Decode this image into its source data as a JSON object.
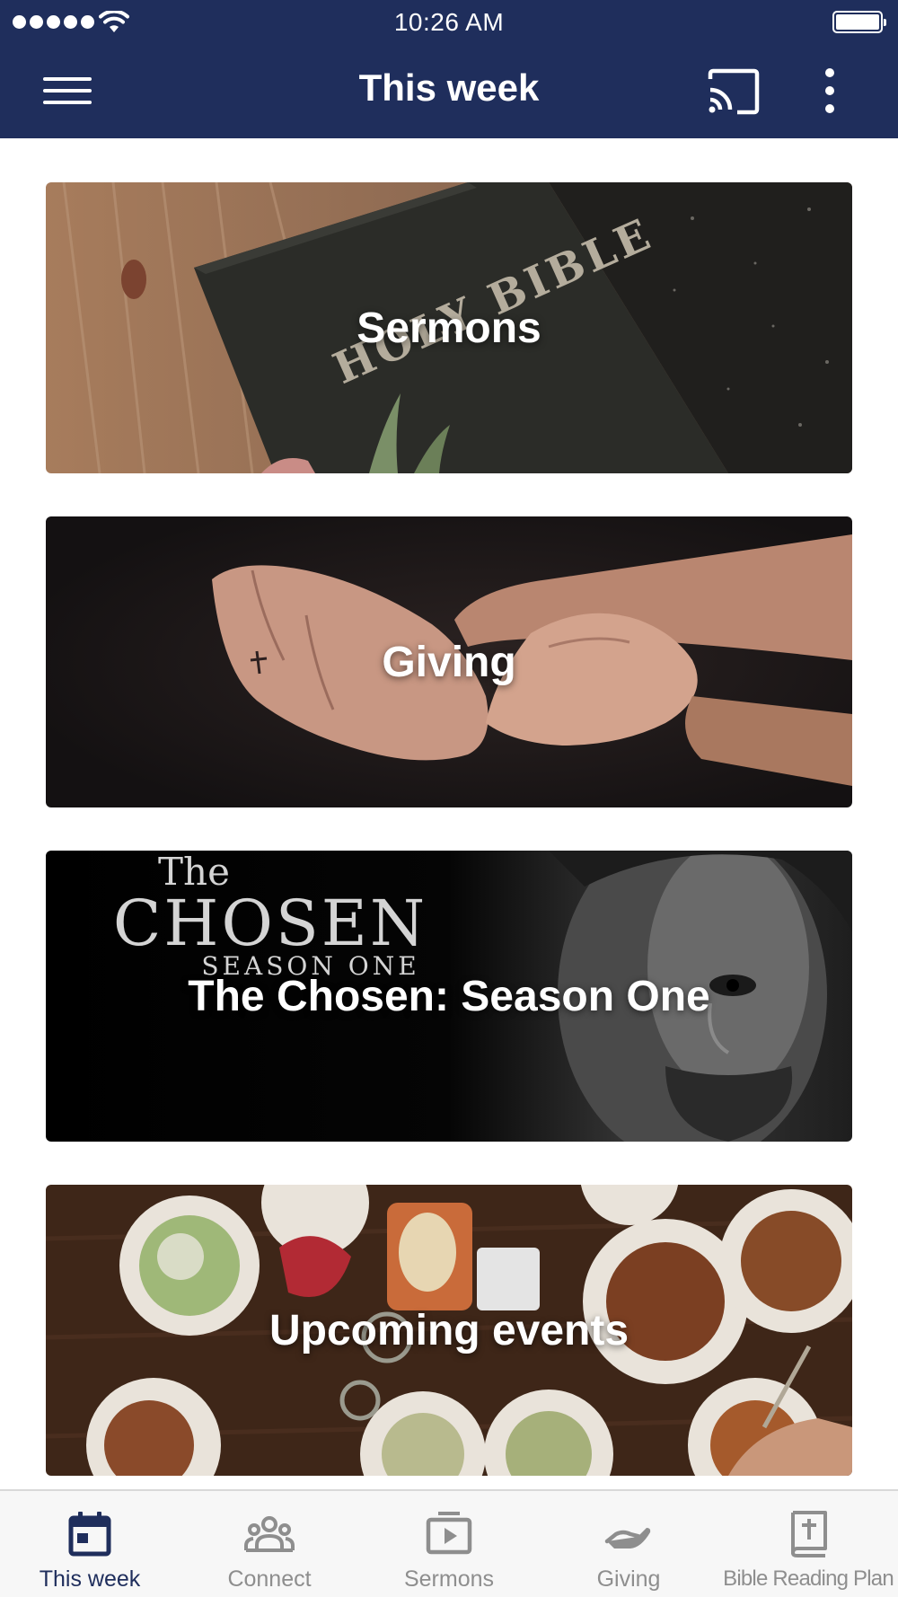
{
  "status_bar": {
    "time": "10:26 AM",
    "signal_bars": 5,
    "battery_level": 1.0
  },
  "header": {
    "title": "This week",
    "menu_icon": "hamburger-menu-icon",
    "cast_icon": "cast-icon",
    "more_icon": "more-vertical-icon",
    "background_color": "#1f2e5c"
  },
  "cards": [
    {
      "title": "Sermons",
      "image_text": [
        "HOLY BIBLE"
      ]
    },
    {
      "title": "Giving"
    },
    {
      "title": "The Chosen: Season One",
      "image_text": [
        "The",
        "CHOSEN",
        "SEASON ONE"
      ]
    },
    {
      "title": "Upcoming events"
    }
  ],
  "tab_bar": {
    "active_index": 0,
    "active_color": "#1f2e5c",
    "inactive_color": "#8e8e8e",
    "tabs": [
      {
        "label": "This week",
        "icon": "calendar-icon"
      },
      {
        "label": "Connect",
        "icon": "people-icon"
      },
      {
        "label": "Sermons",
        "icon": "video-play-icon"
      },
      {
        "label": "Giving",
        "icon": "giving-hand-icon"
      },
      {
        "label": "Bible Reading Plan",
        "icon": "bible-icon"
      }
    ]
  }
}
